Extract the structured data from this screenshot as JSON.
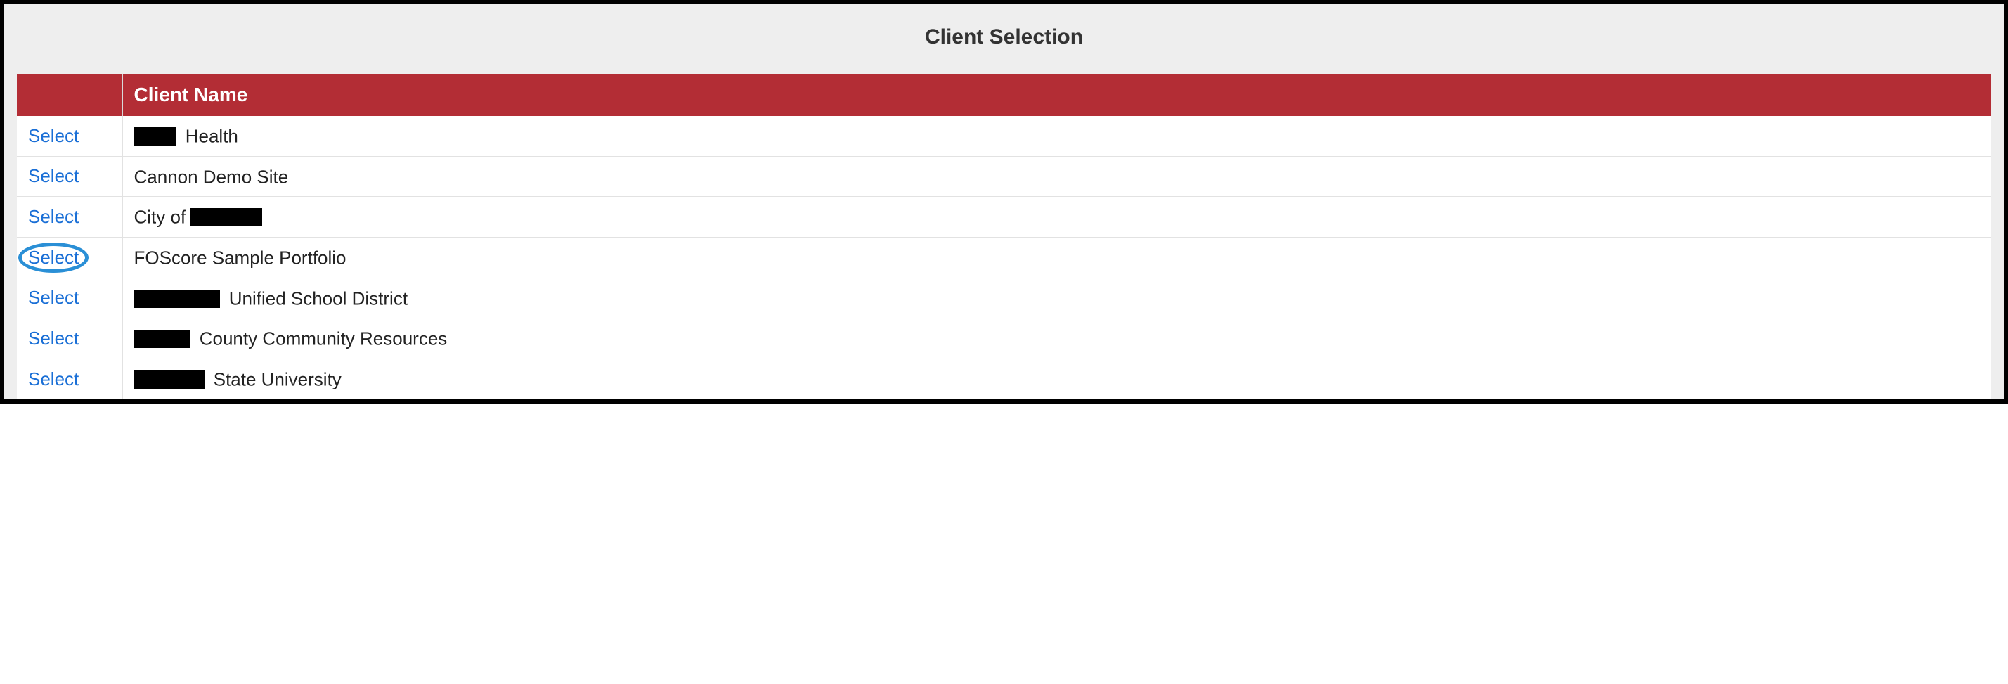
{
  "header": {
    "title": "Client Selection"
  },
  "table": {
    "action_header": "",
    "name_header": "Client Name",
    "select_label": "Select",
    "rows": [
      {
        "redact_before": "r1",
        "name_suffix": " Health"
      },
      {
        "redact_before": null,
        "name_suffix": "Cannon Demo Site"
      },
      {
        "redact_before": null,
        "name_prefix": "City of ",
        "redact_after": "r2"
      },
      {
        "redact_before": null,
        "name_suffix": "FOScore Sample Portfolio",
        "highlight": true
      },
      {
        "redact_before": "r3",
        "name_suffix": " Unified School District"
      },
      {
        "redact_before": "r4",
        "name_suffix": " County Community Resources"
      },
      {
        "redact_before": "r5",
        "name_suffix": " State University"
      }
    ]
  }
}
